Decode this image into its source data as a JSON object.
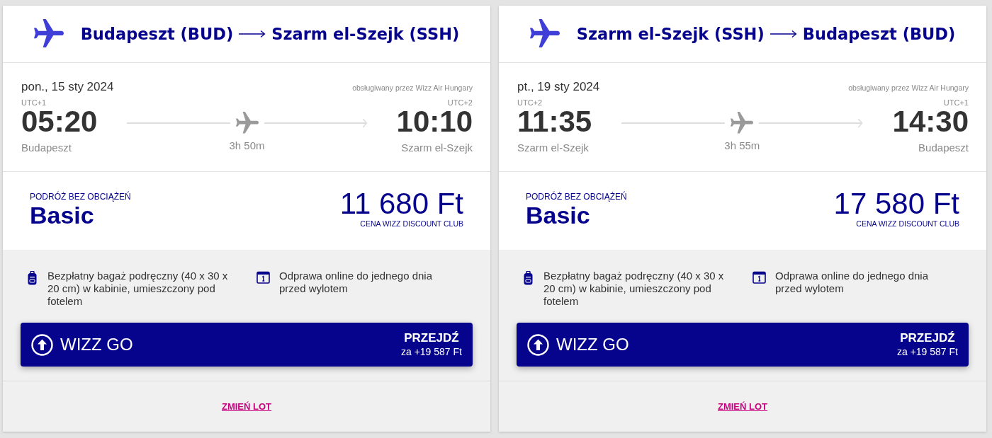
{
  "flights": [
    {
      "route": {
        "origin": "Budapeszt (BUD)",
        "destination": "Szarm el-Szejk (SSH)"
      },
      "date": "pon., 15 sty 2024",
      "operator": "obsługiwany przez Wizz Air Hungary",
      "departure": {
        "timezone": "UTC+1",
        "time": "05:20",
        "city": "Budapeszt"
      },
      "duration": "3h 50m",
      "arrival": {
        "timezone": "UTC+2",
        "time": "10:10",
        "city": "Szarm el-Szejk"
      },
      "fare": {
        "label": "PODRÓŻ BEZ OBCIĄŻEŃ",
        "name": "Basic",
        "price": "11 680 Ft",
        "price_note": "CENA WIZZ DISCOUNT CLUB"
      },
      "features": [
        {
          "kind": "baggage",
          "text": "Bezpłatny bagaż podręczny (40 x 30 x 20 cm) w kabinie, umieszczony pod fotelem"
        },
        {
          "kind": "checkin",
          "text": "Odprawa online do jednego dnia przed wylotem"
        }
      ],
      "upgrade": {
        "name": "WIZZ GO",
        "action": "PRZEJDŹ",
        "price": "za +19 587 Ft"
      },
      "change_link": "ZMIEŃ LOT"
    },
    {
      "route": {
        "origin": "Szarm el-Szejk (SSH)",
        "destination": "Budapeszt (BUD)"
      },
      "date": "pt., 19 sty 2024",
      "operator": "obsługiwany przez Wizz Air Hungary",
      "departure": {
        "timezone": "UTC+2",
        "time": "11:35",
        "city": "Szarm el-Szejk"
      },
      "duration": "3h 55m",
      "arrival": {
        "timezone": "UTC+1",
        "time": "14:30",
        "city": "Budapeszt"
      },
      "fare": {
        "label": "PODRÓŻ BEZ OBCIĄŻEŃ",
        "name": "Basic",
        "price": "17 580 Ft",
        "price_note": "CENA WIZZ DISCOUNT CLUB"
      },
      "features": [
        {
          "kind": "baggage",
          "text": "Bezpłatny bagaż podręczny (40 x 30 x 20 cm) w kabinie, umieszczony pod fotelem"
        },
        {
          "kind": "checkin",
          "text": "Odprawa online do jednego dnia przed wylotem"
        }
      ],
      "upgrade": {
        "name": "WIZZ GO",
        "action": "PRZEJDŹ",
        "price": "za +19 587 Ft"
      },
      "change_link": "ZMIEŃ LOT"
    }
  ]
}
